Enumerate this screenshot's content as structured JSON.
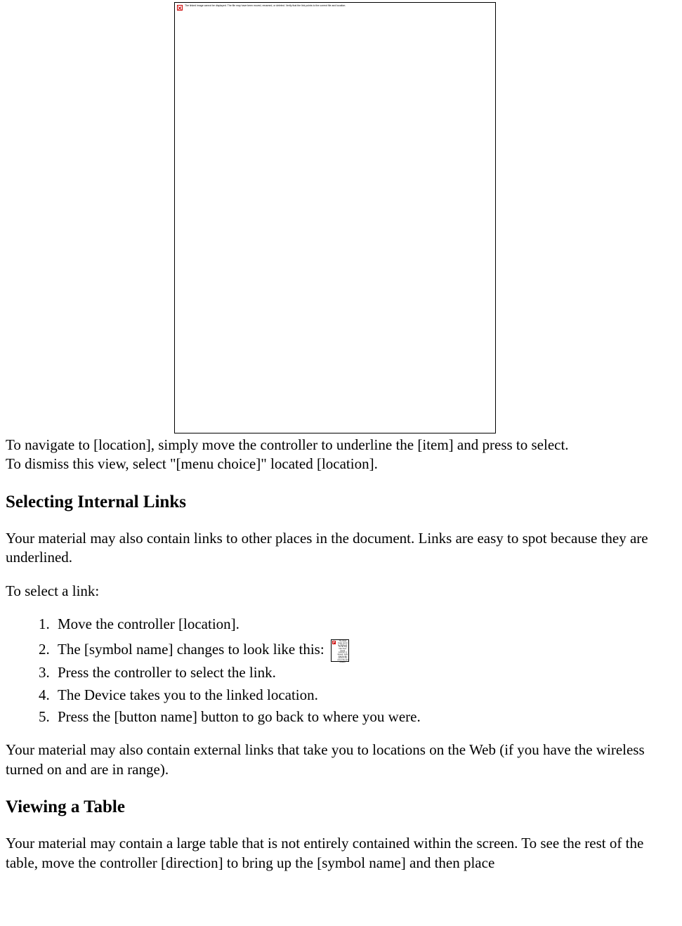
{
  "image_large": {
    "alt": "The linked image cannot be displayed. The file may have been moved, renamed, or deleted. Verify that the link points to the correct file and location."
  },
  "image_small": {
    "alt": "The linked image cannot be displayed. The file may have been moved, renamed, or deleted. Verify that the link points to the correct file and location."
  },
  "intro": {
    "line1": "To navigate to [location], simply move the controller to underline the [item] and press to select.",
    "line2": "To dismiss this view, select \"[menu choice]\" located [location]."
  },
  "section1": {
    "heading": "Selecting Internal Links",
    "para1": "Your material may also contain links to other places in the document. Links are easy to spot because they are underlined.",
    "para2": "To select a link:",
    "steps": [
      "Move the controller [location].",
      "The [symbol name] changes to look like this:",
      "Press the controller to select the link.",
      "The Device takes you to the linked location.",
      "Press the [button name] button to go back to where you were."
    ],
    "para3": "Your material may also contain external links that take you to locations on the Web (if you have the wireless turned on and are in range)."
  },
  "section2": {
    "heading": "Viewing a Table",
    "para1": "Your material may contain a large table that is not entirely contained within the screen. To see the rest of the table, move the controller [direction] to bring up the [symbol name] and then place"
  }
}
